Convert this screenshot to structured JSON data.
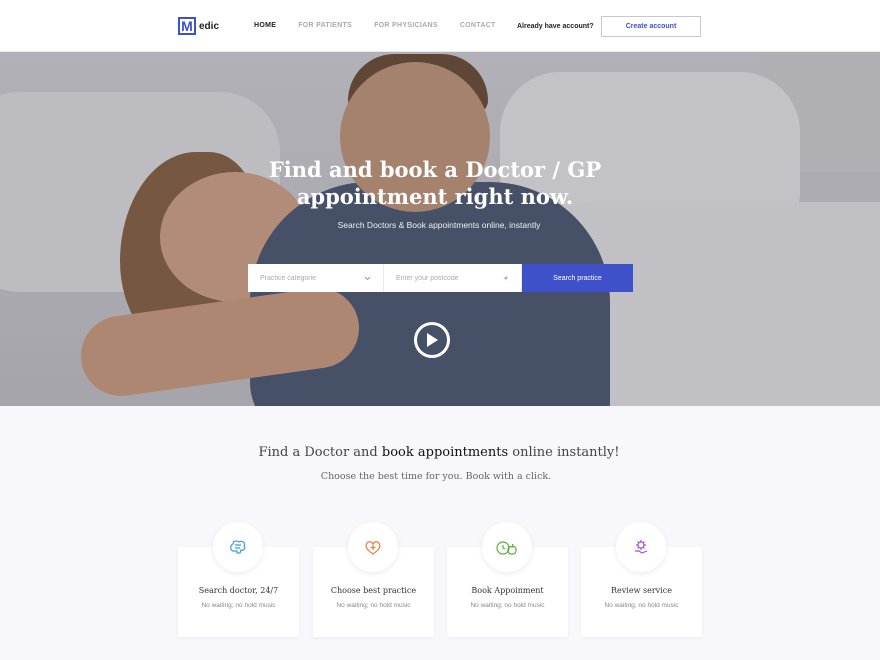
{
  "header": {
    "logo_letter": "M",
    "logo_text": "edic",
    "nav": [
      "HOME",
      "FOR PATIENTS",
      "FOR PHYSICIANS",
      "CONTACT"
    ],
    "account_text": "Already have account?",
    "create_label": "Create account",
    "accent": "#3f51c9"
  },
  "hero": {
    "title_line1": "Find and book a Doctor / GP",
    "title_line2": "appointment right now.",
    "subtitle": "Search Doctors & Book appointments online, instantly",
    "category_placeholder": "Practice categorie",
    "postcode_placeholder": "Enter your postcode",
    "search_label": "Search practice"
  },
  "section": {
    "title_pre": "Find a Doctor and ",
    "title_highlight": "book appointments",
    "title_post": " online instantly!",
    "subtitle": "Choose the best time for you. Book with a click."
  },
  "features": [
    {
      "title": "Search doctor, 24/7",
      "sub": "No waiting; no hold music",
      "icon": "brain-icon",
      "color": "#3a9fd6"
    },
    {
      "title": "Choose best practice",
      "sub": "No waiting; no hold music",
      "icon": "heart-plus-icon",
      "color": "#e8803a"
    },
    {
      "title": "Book Appoinment",
      "sub": "No waiting; no hold music",
      "icon": "clock-apple-icon",
      "color": "#5aae3a"
    },
    {
      "title": "Review service",
      "sub": "No waiting; no hold music",
      "icon": "gear-hand-icon",
      "color": "#9b4fd6"
    }
  ]
}
